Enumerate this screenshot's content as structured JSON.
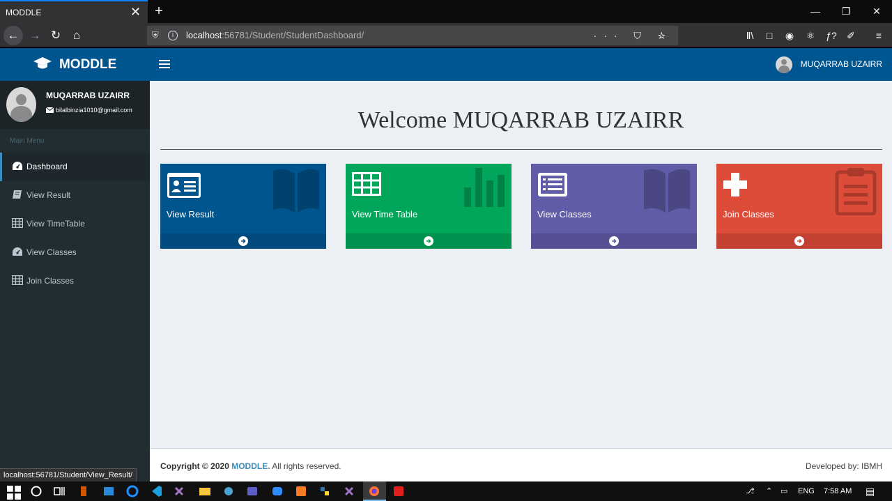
{
  "browser": {
    "tab_title": "MODDLE",
    "tab_close": "✕",
    "new_tab": "+",
    "url_host": "localhost",
    "url_rest": ":56781/Student/StudentDashboard/",
    "url_actions": "··· ⛉ ☆",
    "status_url": "localhost:56781/Student/View_Result/"
  },
  "header": {
    "brand": "MODDLE",
    "user_name": "MUQARRAB UZAIRR"
  },
  "sidebar": {
    "profile_name": "MUQARRAB UZAIRR",
    "profile_email": "bilalbinzia1010@gmail.com",
    "menu_header": "Main Menu",
    "items": [
      {
        "label": "Dashboard",
        "icon": "dashboard-icon"
      },
      {
        "label": "View Result",
        "icon": "book-icon"
      },
      {
        "label": "View TimeTable",
        "icon": "table-icon"
      },
      {
        "label": "View Classes",
        "icon": "dashboard-icon"
      },
      {
        "label": "Join Classes",
        "icon": "table-icon"
      }
    ]
  },
  "main": {
    "welcome": "Welcome MUQARRAB UZAIRR",
    "cards": [
      {
        "label": "View Result",
        "color": "#00558f",
        "icon": "id-card-icon"
      },
      {
        "label": "View Time Table",
        "color": "#00a65a",
        "icon": "table-icon"
      },
      {
        "label": "View Classes",
        "color": "#605ca8",
        "icon": "list-icon"
      },
      {
        "label": "Join Classes",
        "color": "#dd4b39",
        "icon": "plus-icon"
      }
    ]
  },
  "footer": {
    "copyright_prefix": "Copyright © 2020",
    "brand": "MODDLE.",
    "copyright_suffix": "All rights reserved.",
    "developed": "Developed by: IBMH"
  },
  "taskbar": {
    "lang": "ENG",
    "time": "7:58 AM"
  }
}
